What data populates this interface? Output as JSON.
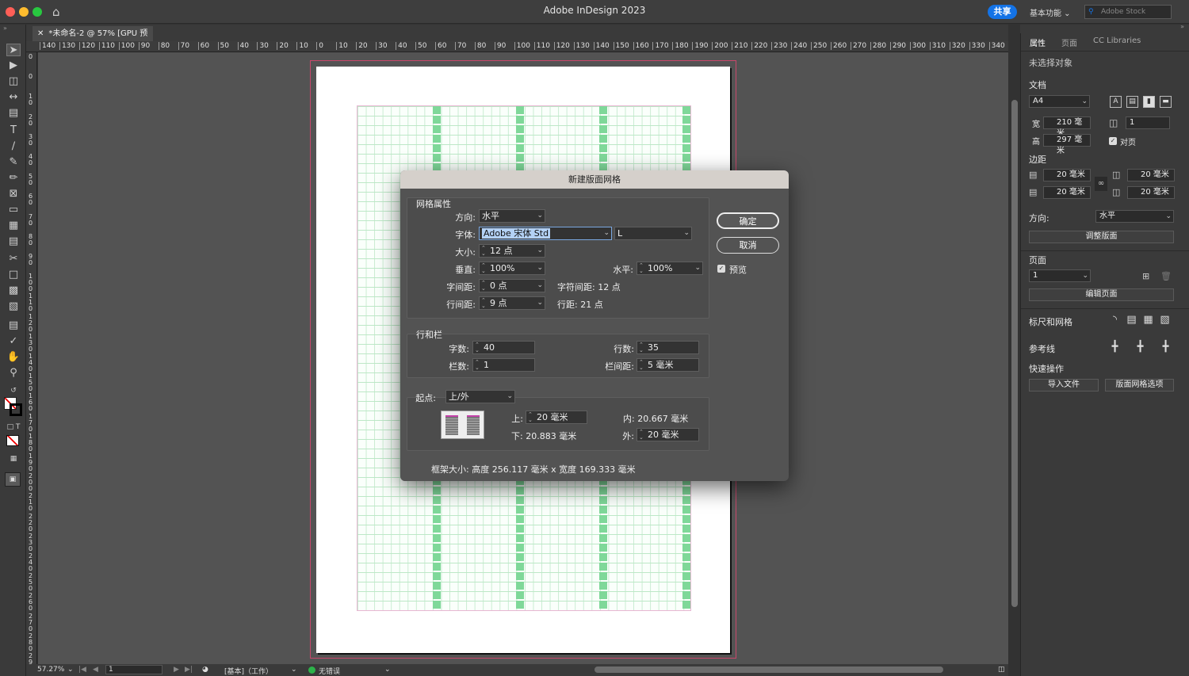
{
  "app": {
    "title": "Adobe InDesign 2023",
    "share": "共享",
    "workspace": "基本功能",
    "stock_placeholder": "Adobe Stock"
  },
  "doc": {
    "tab": "*未命名-2 @ 57% [GPU 预览]"
  },
  "ruler": {
    "h": [
      "140",
      "130",
      "120",
      "110",
      "100",
      "90",
      "80",
      "70",
      "60",
      "50",
      "40",
      "30",
      "20",
      "10",
      "0",
      "10",
      "20",
      "30",
      "40",
      "50",
      "60",
      "70",
      "80",
      "90",
      "100",
      "110",
      "120",
      "130",
      "140",
      "150",
      "160",
      "170",
      "180",
      "190",
      "200",
      "210",
      "220",
      "230",
      "240",
      "250",
      "260",
      "270",
      "280",
      "290",
      "300",
      "310",
      "320",
      "330",
      "340"
    ],
    "v": [
      "0",
      "0",
      "1 0",
      "2 0",
      "3 0",
      "4 0",
      "5 0",
      "6 0",
      "7 0",
      "8 0",
      "9 0",
      "1 0 0",
      "1 1 0",
      "1 2 0",
      "1 3 0",
      "1 4 0",
      "1 5 0",
      "1 6 0",
      "1 7 0",
      "1 8 0",
      "1 9 0",
      "2 0 0",
      "2 1 0",
      "2 2 0",
      "2 3 0",
      "2 4 0",
      "2 5 0",
      "2 6 0",
      "2 7 0",
      "2 8 0",
      "2 9 0"
    ]
  },
  "status": {
    "zoom": "57.27%",
    "page": "1",
    "style": "[基本]（工作）",
    "errors": "无错误"
  },
  "panel": {
    "tabs": [
      "属性",
      "页面",
      "CC Libraries"
    ],
    "no_selection": "未选择对象",
    "doc_section": "文档",
    "page_size": "A4",
    "width_label": "宽",
    "width": "210 毫米",
    "height_label": "高",
    "height": "297 毫米",
    "pages": "1",
    "facing": "对页",
    "margins_section": "边距",
    "m_top": "20 毫米",
    "m_bottom": "20 毫米",
    "m_left": "20 毫米",
    "m_right": "20 毫米",
    "direction_label": "方向:",
    "direction": "水平",
    "adjust_layout": "调整版面",
    "pages_section": "页面",
    "page_num": "1",
    "edit_page": "编辑页面",
    "rulers_grids": "标尺和网格",
    "guides": "参考线",
    "quick_actions": "快速操作",
    "import_file": "导入文件",
    "grid_options": "版面网格选项"
  },
  "dialog": {
    "title": "新建版面网格",
    "grid_props": "网格属性",
    "direction_label": "方向:",
    "direction": "水平",
    "font_label": "字体:",
    "font": "Adobe 宋体 Std",
    "font_style": "L",
    "size_label": "大小:",
    "size": "12 点",
    "vert_label": "垂直:",
    "vert": "100%",
    "horiz_label": "水平:",
    "horiz": "100%",
    "char_aki_label": "字间距:",
    "char_aki": "0 点",
    "char_pitch": "字符间距: 12 点",
    "line_aki_label": "行间距:",
    "line_aki": "9 点",
    "line_pitch": "行距: 21 点",
    "rows_cols": "行和栏",
    "chars_label": "字数:",
    "chars": "40",
    "lines_label": "行数:",
    "lines": "35",
    "cols_label": "栏数:",
    "cols": "1",
    "gutter_label": "栏间距:",
    "gutter": "5 毫米",
    "start_label": "起点:",
    "start": "上/外",
    "top_label": "上:",
    "top": "20 毫米",
    "inner": "内: 20.667 毫米",
    "bottom": "下: 20.883 毫米",
    "outer_label": "外:",
    "outer": "20 毫米",
    "frame_size": "框架大小: 高度 256.117 毫米 x 宽度 169.333 毫米",
    "ok": "确定",
    "cancel": "取消",
    "preview": "预览"
  }
}
